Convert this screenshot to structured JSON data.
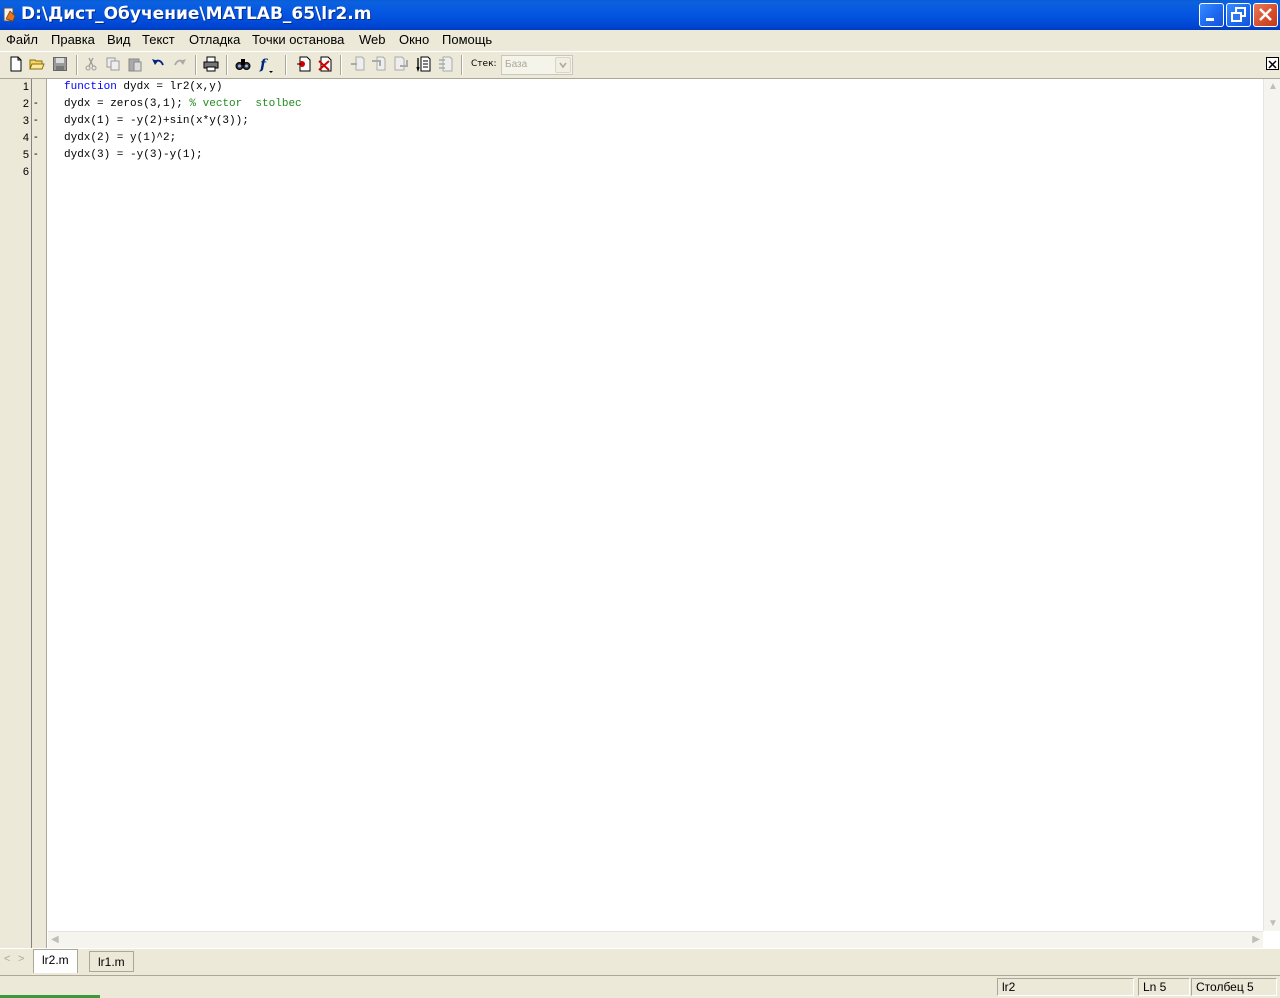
{
  "window": {
    "title": "D:\\Дист_Обучение\\MATLAB_65\\lr2.m"
  },
  "menu": {
    "items": [
      "Файл",
      "Правка",
      "Вид",
      "Текст",
      "Отладка",
      "Точки останова",
      "Web",
      "Окно",
      "Помощь"
    ]
  },
  "toolbar": {
    "icons": [
      "new-file-icon",
      "open-folder-icon",
      "save-icon",
      "cut-icon",
      "copy-icon",
      "paste-icon",
      "undo-icon",
      "redo-icon",
      "print-icon",
      "find-icon",
      "function-icon",
      "set-breakpoint-icon",
      "clear-breakpoints-icon",
      "step-icon",
      "step-in-icon",
      "step-out-icon",
      "continue-icon",
      "exit-debug-icon"
    ],
    "stack_label": "Стек:",
    "stack_value": "База"
  },
  "editor": {
    "line_numbers": [
      "1",
      "2",
      "3",
      "4",
      "5",
      "6"
    ],
    "lines": [
      {
        "keyword": "function",
        "text": " dydx = lr2(x,y)",
        "comment": "",
        "breakpoint_dash": ""
      },
      {
        "keyword": "",
        "text": "dydx = zeros(3,1); ",
        "comment": "% vector  stolbec",
        "breakpoint_dash": "-"
      },
      {
        "keyword": "",
        "text": "dydx(1) = -y(2)+sin(x*y(3));",
        "comment": "",
        "breakpoint_dash": "-"
      },
      {
        "keyword": "",
        "text": "dydx(2) = y(1)^2;",
        "comment": "",
        "breakpoint_dash": "-"
      },
      {
        "keyword": "",
        "text": "dydx(3) = -y(3)-y(1);",
        "comment": "",
        "breakpoint_dash": "-"
      },
      {
        "keyword": "",
        "text": "",
        "comment": "",
        "breakpoint_dash": ""
      }
    ]
  },
  "tabs": [
    {
      "label": "lr2.m",
      "active": true
    },
    {
      "label": "lr1.m",
      "active": false
    }
  ],
  "status": {
    "function_name": "lr2",
    "line": "Ln 5",
    "column": "Столбец 5"
  }
}
